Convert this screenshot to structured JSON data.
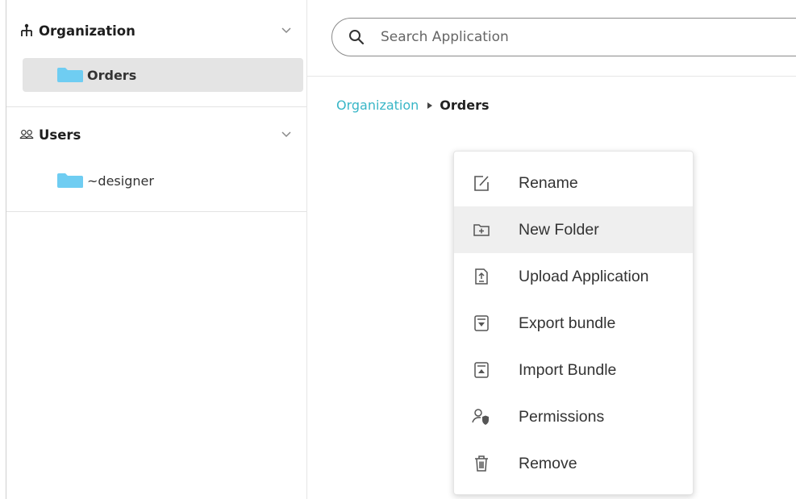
{
  "sidebar": {
    "organization": {
      "title": "Organization",
      "folders": [
        {
          "label": "Orders",
          "selected": true
        }
      ]
    },
    "users": {
      "title": "Users",
      "folders": [
        {
          "label": "~designer",
          "selected": false
        }
      ]
    }
  },
  "search": {
    "placeholder": "Search Application",
    "value": ""
  },
  "breadcrumb": {
    "root": "Organization",
    "current": "Orders"
  },
  "context_menu": {
    "items": [
      {
        "label": "Rename",
        "icon": "edit-icon"
      },
      {
        "label": "New Folder",
        "icon": "new-folder-icon",
        "hovered": true
      },
      {
        "label": "Upload Application",
        "icon": "upload-file-icon"
      },
      {
        "label": "Export bundle",
        "icon": "export-icon"
      },
      {
        "label": "Import Bundle",
        "icon": "import-icon"
      },
      {
        "label": "Permissions",
        "icon": "permissions-icon"
      },
      {
        "label": "Remove",
        "icon": "trash-icon"
      }
    ]
  },
  "colors": {
    "accent": "#38b6c7",
    "folder": "#6fcdf2",
    "selected_bg": "#e4e4e4",
    "hover_bg": "#efefef"
  }
}
